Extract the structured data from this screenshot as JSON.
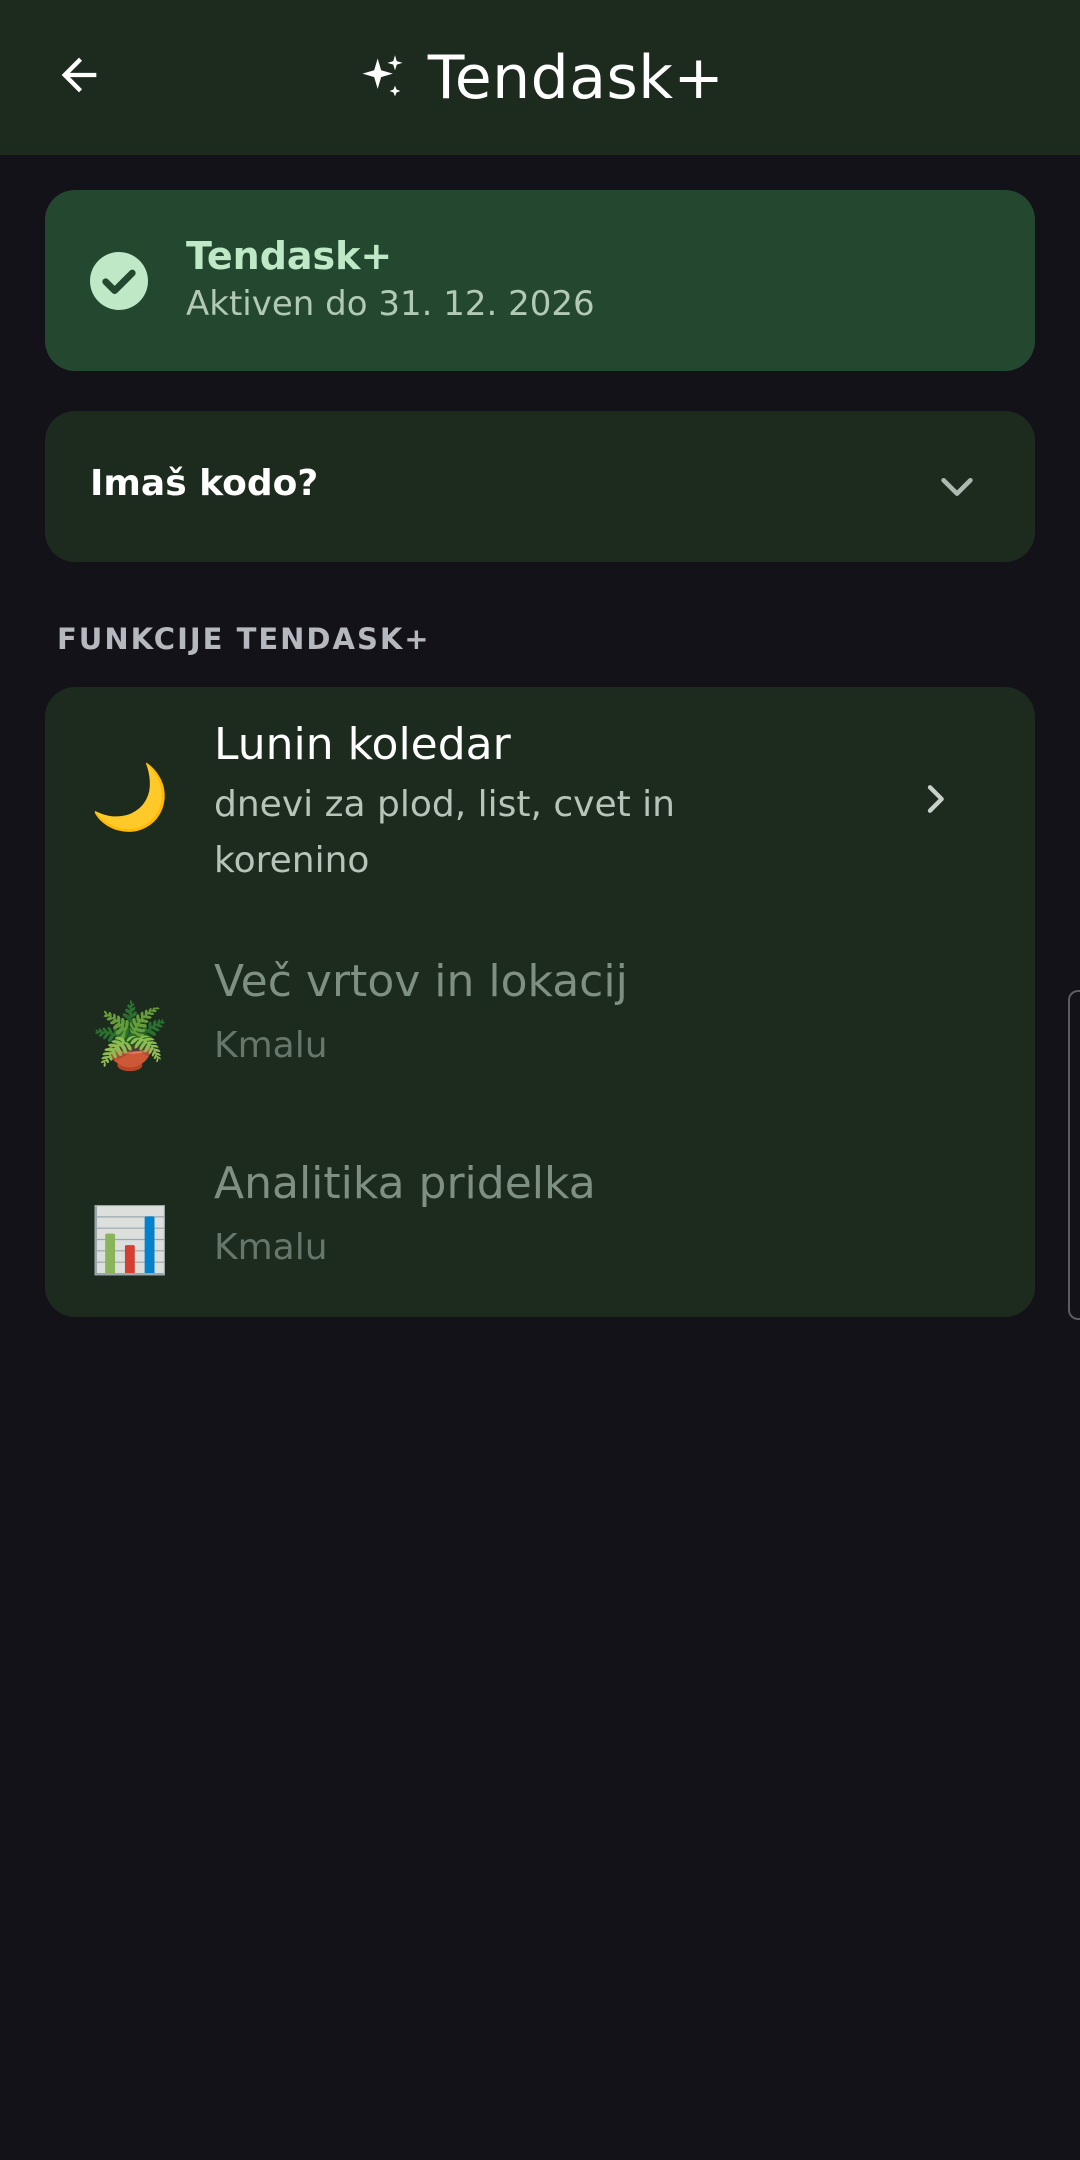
{
  "app_bar": {
    "title": "Tendask+",
    "back_icon": "arrow-left-icon",
    "title_icon": "sparkles-icon"
  },
  "status_card": {
    "title": "Tendask+",
    "subtitle": "Aktiven do 31. 12. 2026",
    "icon": "check-circle-icon"
  },
  "code_card": {
    "label": "Imaš kodo?",
    "icon": "chevron-down-icon"
  },
  "section": {
    "header": "FUNKCIJE TENDASK+"
  },
  "features": [
    {
      "icon": "🌙",
      "title": "Lunin koledar",
      "subtitle": "dnevi za plod, list, cvet in korenino",
      "enabled": true
    },
    {
      "icon": "🪴",
      "title": "Več vrtov in lokacij",
      "subtitle": "Kmalu",
      "enabled": false
    },
    {
      "icon": "📊",
      "title": "Analitika pridelka",
      "subtitle": "Kmalu",
      "enabled": false
    }
  ],
  "colors": {
    "background": "#131218",
    "app_bar": "#1c2b1e",
    "status_card": "#244730",
    "card": "#1c2b1e",
    "accent": "#bfe8c6"
  }
}
